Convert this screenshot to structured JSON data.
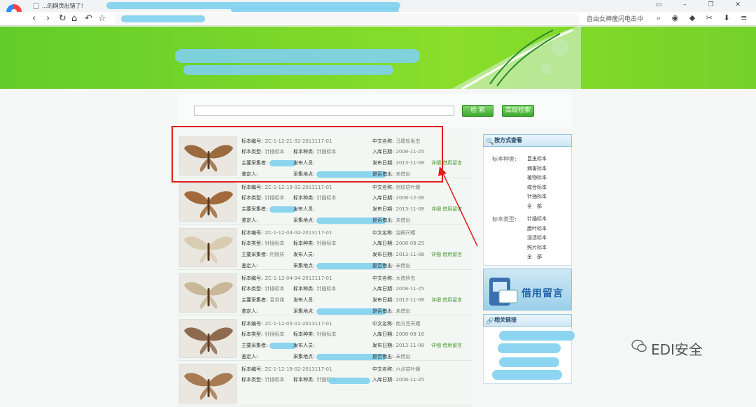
{
  "browser": {
    "tab_title": "...的网页出错了!",
    "win_controls": "▭ – ❐ ✕",
    "nav": {
      "back": "‹",
      "forward": "›",
      "reload": "↻",
      "home": "⌂",
      "undo": "↶",
      "star": "☆"
    },
    "toolbar_right": "自由女神瘦闪电击中",
    "toolbar_icons": "⌕ ◉ ◆ ✂ ⬇ ≡"
  },
  "search": {
    "button_search": "检 索",
    "button_advanced": "高级检索",
    "input_value": ""
  },
  "labels": {
    "id": "标本编号:",
    "cn_name": "中文名称:",
    "type": "标本类型:",
    "kind": "标本种类:",
    "in_date": "入库日期:",
    "collector": "主要采集者:",
    "publisher": "发布人员:",
    "pub_date": "发布日期:",
    "identifier": "鉴定人:",
    "place": "采集地点:",
    "borrowed": "是否借出:",
    "detail": "详细",
    "borrow_msg": "借用留言"
  },
  "items": [
    {
      "id": "ZC-1-12-21-02-2013117-01",
      "cn_name": "马尾松毛虫",
      "type": "针插标本",
      "kind": "针插标本",
      "in_date": "2008-11-25",
      "collector": "",
      "pub_date": "2013-11-08",
      "borrowed": "未借出"
    },
    {
      "id": "ZC-1-12-19-02-2013117-01",
      "cn_name": "剑纹枯叶蛾",
      "type": "针插标本",
      "kind": "针插标本",
      "in_date": "2008-12-06",
      "collector": "",
      "pub_date": "2013-11-08",
      "borrowed": "未借出"
    },
    {
      "id": "ZC-1-12-04-04-2013117-01",
      "cn_name": "油桐尺蠖",
      "type": "针插标本",
      "kind": "针插标本",
      "in_date": "2008-08-25",
      "collector": "何刚庆",
      "pub_date": "2013-11-08",
      "borrowed": "未借出"
    },
    {
      "id": "ZC-1-12-04-04-2013117-01",
      "cn_name": "大造桥虫",
      "type": "针插标本",
      "kind": "针插标本",
      "in_date": "2008-11-25",
      "collector": "袁世伟",
      "pub_date": "2013-11-08",
      "borrowed": "未借出"
    },
    {
      "id": "ZC-1-12-05-01-2013117-01",
      "cn_name": "南方豆天蛾",
      "type": "针插标本",
      "kind": "针插标本",
      "in_date": "2008-08-16",
      "collector": "",
      "pub_date": "2013-11-08",
      "borrowed": "未借出"
    },
    {
      "id": "ZC-1-12-19-02-2013117-01",
      "cn_name": "六点枯叶蛾",
      "type": "针插标本",
      "kind": "针插标本",
      "in_date": "2008-11-25",
      "collector": "",
      "pub_date": "",
      "borrowed": ""
    }
  ],
  "sidebar": {
    "browse_title": "按方式查看",
    "kind_label": "标本种类:",
    "kind_links": [
      "昆虫标本",
      "病害标本",
      "植物标本",
      "综合标本",
      "针插标本",
      "全　部"
    ],
    "type_label": "标本类型:",
    "type_links": [
      "针插标本",
      "腊叶标本",
      "浸渍标本",
      "照片标本",
      "全　部"
    ],
    "borrow_banner": "借用留言",
    "links_title": "相关链接"
  },
  "watermark": "EDI安全",
  "colors": {
    "banner": "#74d12a",
    "highlight": "#e01d1d",
    "link": "#4a9a2f"
  }
}
